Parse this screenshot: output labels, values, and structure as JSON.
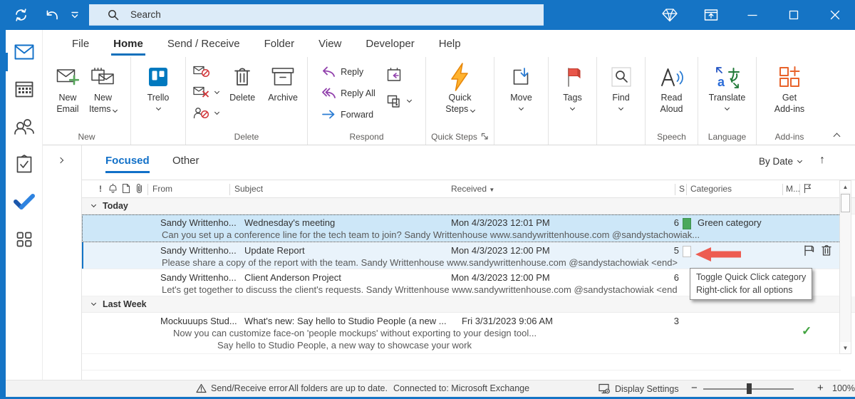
{
  "titlebar": {
    "search_placeholder": "Search"
  },
  "menu": {
    "tabs": [
      "File",
      "Home",
      "Send / Receive",
      "Folder",
      "View",
      "Developer",
      "Help"
    ],
    "active_tab": "Home"
  },
  "ribbon": {
    "new_email": {
      "l1": "New",
      "l2": "Email"
    },
    "new_items": {
      "l1": "New",
      "l2": "Items"
    },
    "trello": {
      "label": "Trello"
    },
    "delete": {
      "label": "Delete"
    },
    "archive": {
      "label": "Archive"
    },
    "reply": {
      "label": "Reply"
    },
    "reply_all": {
      "label": "Reply All"
    },
    "forward": {
      "label": "Forward"
    },
    "quick_steps": {
      "l1": "Quick",
      "l2": "Steps"
    },
    "move": {
      "label": "Move"
    },
    "tags": {
      "label": "Tags"
    },
    "find": {
      "label": "Find"
    },
    "read_aloud": {
      "l1": "Read",
      "l2": "Aloud"
    },
    "translate": {
      "label": "Translate"
    },
    "get_addins": {
      "l1": "Get",
      "l2": "Add-ins"
    },
    "groups": {
      "new": "New",
      "delete": "Delete",
      "respond": "Respond",
      "quick_steps": "Quick Steps",
      "speech": "Speech",
      "language": "Language",
      "addins": "Add-ins"
    }
  },
  "list": {
    "tabs": {
      "focused": "Focused",
      "other": "Other"
    },
    "sort_label": "By Date",
    "columns": {
      "importance": "!",
      "from": "From",
      "subject": "Subject",
      "received": "Received",
      "size": "S",
      "categories": "Categories",
      "mention": "M..."
    },
    "group_today": "Today",
    "group_lastweek": "Last Week",
    "emails": [
      {
        "from": "Sandy Writtenho...",
        "subject": "Wednesday's meeting",
        "received": "Mon 4/3/2023 12:01 PM",
        "size": "6",
        "category": "Green category",
        "preview": "Can you set up a conference line for the tech team to join?  Sandy Writtenhouse  www.sandywrittenhouse.com  @sandystachowiak..."
      },
      {
        "from": "Sandy Writtenho...",
        "subject": "Update Report",
        "received": "Mon 4/3/2023 12:00 PM",
        "size": "5",
        "preview": "Please share a copy of the report with the team.  Sandy Writtenhouse  www.sandywrittenhouse.com  @sandystachowiak <end>"
      },
      {
        "from": "Sandy Writtenho...",
        "subject": "Client Anderson Project",
        "received": "Mon 4/3/2023 12:00 PM",
        "size": "6",
        "preview": "Let's get together to discuss the client's requests.  Sandy Writtenhouse  www.sandywrittenhouse.com  @sandystachowiak <end"
      },
      {
        "from": "Mockuuups Stud...",
        "subject": "What's new: Say hello to Studio People (a new ...",
        "received": "Fri 3/31/2023 9:06 AM",
        "size": "3",
        "preview": "Now you can customize face-on 'people mockups' without exporting to your design tool...",
        "preview2": "Say hello to Studio People, a new way to showcase your work"
      }
    ]
  },
  "tooltip": {
    "line1": "Toggle Quick Click category",
    "line2": "Right-click for all options"
  },
  "statusbar": {
    "error": "Send/Receive error",
    "status": "All folders are up to date.",
    "connection": "Connected to: Microsoft Exchange",
    "display_settings": "Display Settings",
    "zoom": "100%"
  },
  "colors": {
    "titlebar_blue": "#1574c5",
    "accent_blue": "#1270bc",
    "category_green": "#4aa85c",
    "arrow_red": "#ed5c51",
    "selection_blue": "#cde7f8"
  }
}
